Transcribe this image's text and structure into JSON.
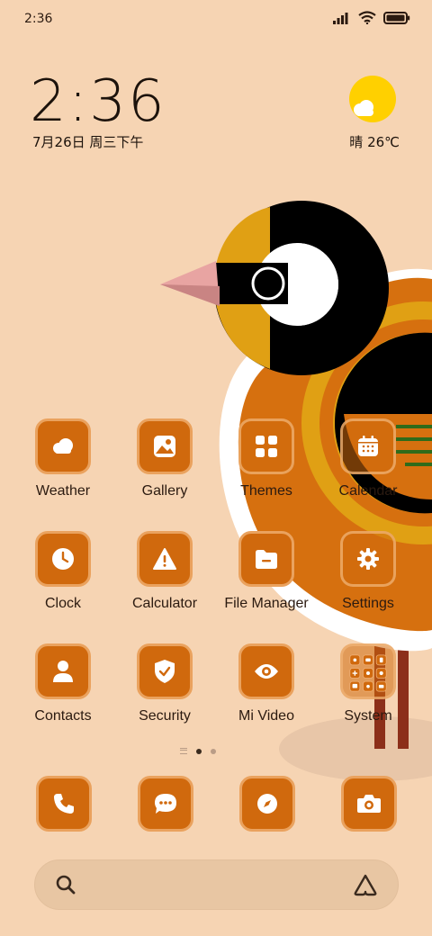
{
  "status_bar": {
    "time": "2:36",
    "icons": [
      "signal-icon",
      "wifi-icon",
      "battery-icon"
    ]
  },
  "clock_widget": {
    "time": "2:36",
    "date": "7月26日 周三下午"
  },
  "weather_widget": {
    "condition": "晴",
    "temperature": "26℃",
    "icon": "partly-sunny-icon"
  },
  "apps": [
    {
      "label": "Weather",
      "icon": "weather-cloud-icon"
    },
    {
      "label": "Gallery",
      "icon": "gallery-icon"
    },
    {
      "label": "Themes",
      "icon": "themes-icon"
    },
    {
      "label": "Calendar",
      "icon": "calendar-icon"
    },
    {
      "label": "Clock",
      "icon": "clock-icon"
    },
    {
      "label": "Calculator",
      "icon": "warning-triangle-icon"
    },
    {
      "label": "File Manager",
      "icon": "folder-icon"
    },
    {
      "label": "Settings",
      "icon": "gear-icon"
    },
    {
      "label": "Contacts",
      "icon": "person-icon"
    },
    {
      "label": "Security",
      "icon": "shield-check-icon"
    },
    {
      "label": "Mi Video",
      "icon": "eye-icon"
    },
    {
      "label": "System",
      "icon": "folder-grid-icon"
    }
  ],
  "pager": {
    "pages": 2,
    "active": 1
  },
  "dock": [
    {
      "icon": "phone-icon"
    },
    {
      "icon": "message-icon"
    },
    {
      "icon": "compass-icon"
    },
    {
      "icon": "camera-icon"
    }
  ],
  "search": {
    "left_icon": "search-icon",
    "right_icon": "assistant-icon"
  },
  "colors": {
    "background": "#f6d4b3",
    "icon_fill": "#d0690d",
    "icon_border": "#eaa25e",
    "text": "#2b1a10"
  }
}
